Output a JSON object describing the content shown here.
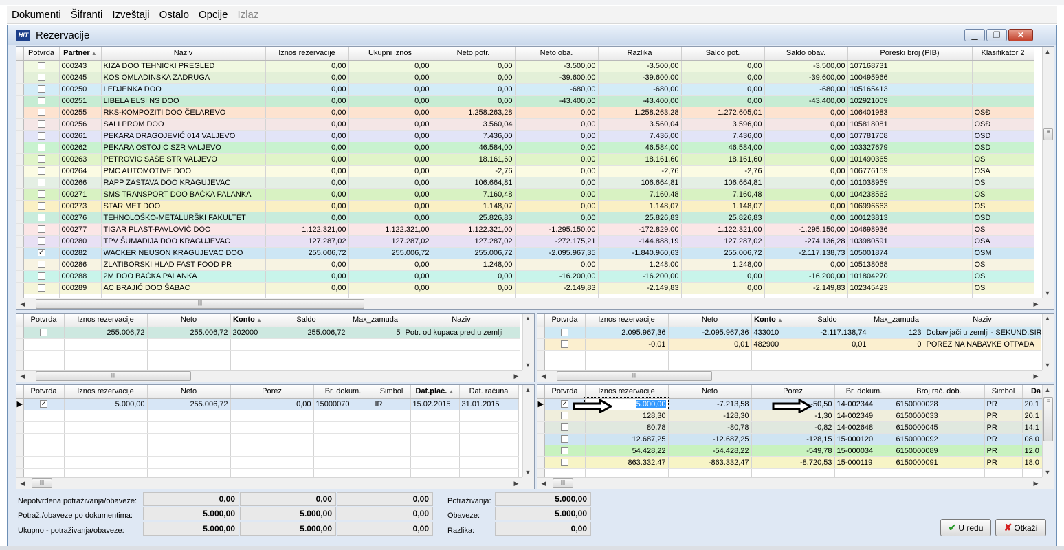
{
  "menu": [
    "Dokumenti",
    "Šifranti",
    "Izveštaji",
    "Ostalo",
    "Opcije",
    "Izlaz"
  ],
  "window": {
    "title": "Rezervacije",
    "logo": "HIT",
    "min_icon": "minimize-icon",
    "max_icon": "restore-icon",
    "close_icon": "close-icon"
  },
  "main_grid": {
    "columns": [
      "Potvrda",
      "Partner",
      "Naziv",
      "Iznos rezervacije",
      "Ukupni iznos",
      "Neto potr.",
      "Neto oba.",
      "Razlika",
      "Saldo pot.",
      "Saldo obav.",
      "Poreski broj (PIB)",
      "Klasifikator 2"
    ],
    "rows": [
      {
        "bg": "#f0f8e0",
        "checked": "",
        "cells": [
          "000243",
          "KIZA DOO TEHNICKI PREGLED",
          "0,00",
          "0,00",
          "0,00",
          "-3.500,00",
          "-3.500,00",
          "0,00",
          "-3.500,00",
          "107168731",
          ""
        ]
      },
      {
        "bg": "#e3f0d8",
        "checked": "",
        "cells": [
          "000245",
          "KOS OMLADINSKA ZADRUGA",
          "0,00",
          "0,00",
          "0,00",
          "-39.600,00",
          "-39.600,00",
          "0,00",
          "-39.600,00",
          "100495966",
          ""
        ]
      },
      {
        "bg": "#d3ecf7",
        "checked": "",
        "cells": [
          "000250",
          "LEDJENKA DOO",
          "0,00",
          "0,00",
          "0,00",
          "-680,00",
          "-680,00",
          "0,00",
          "-680,00",
          "105165413",
          ""
        ]
      },
      {
        "bg": "#c6ecd3",
        "checked": "",
        "cells": [
          "000251",
          "LIBELA ELSI NS DOO",
          "0,00",
          "0,00",
          "0,00",
          "-43.400,00",
          "-43.400,00",
          "0,00",
          "-43.400,00",
          "102921009",
          ""
        ]
      },
      {
        "bg": "#fde3d0",
        "checked": "",
        "cells": [
          "000255",
          "RKS-KOMPOZITI DOO  ČELAREVO",
          "0,00",
          "0,00",
          "1.258.263,28",
          "0,00",
          "1.258.263,28",
          "1.272.605,01",
          "0,00",
          "106401983",
          "OSĐ"
        ]
      },
      {
        "bg": "#f4e6e6",
        "checked": "",
        "cells": [
          "000256",
          "SALI PROM DOO",
          "0,00",
          "0,00",
          "3.560,04",
          "0,00",
          "3.560,04",
          "3.596,00",
          "0,00",
          "105818081",
          "OSĐ"
        ]
      },
      {
        "bg": "#e2e4f7",
        "checked": "",
        "cells": [
          "000261",
          "PEKARA DRAGOJEVIĆ 014  VALJEVO",
          "0,00",
          "0,00",
          "7.436,00",
          "0,00",
          "7.436,00",
          "7.436,00",
          "0,00",
          "107781708",
          "OSD"
        ]
      },
      {
        "bg": "#c8f2cf",
        "checked": "",
        "cells": [
          "000262",
          "PEKARA OSTOJIC SZR  VALJEVO",
          "0,00",
          "0,00",
          "46.584,00",
          "0,00",
          "46.584,00",
          "46.584,00",
          "0,00",
          "103327679",
          "OSD"
        ]
      },
      {
        "bg": "#e0f4c8",
        "checked": "",
        "cells": [
          "000263",
          "PETROVIC SAŠE  STR VALJEVO",
          "0,00",
          "0,00",
          "18.161,60",
          "0,00",
          "18.161,60",
          "18.161,60",
          "0,00",
          "101490365",
          "OS"
        ]
      },
      {
        "bg": "#fbfbe3",
        "checked": "",
        "cells": [
          "000264",
          "PMC AUTOMOTIVE DOO",
          "0,00",
          "0,00",
          "-2,76",
          "0,00",
          "-2,76",
          "-2,76",
          "0,00",
          "106776159",
          "OSA"
        ]
      },
      {
        "bg": "#e4efe4",
        "checked": "",
        "cells": [
          "000266",
          "RAPP ZASTAVA  DOO KRAGUJEVAC",
          "0,00",
          "0,00",
          "106.664,81",
          "0,00",
          "106.664,81",
          "106.664,81",
          "0,00",
          "101038959",
          "OS"
        ]
      },
      {
        "bg": "#d8f2c2",
        "checked": "",
        "cells": [
          "000271",
          "SMS TRANSPORT DOO BAČKA PALANKA",
          "0,00",
          "0,00",
          "7.160,48",
          "0,00",
          "7.160,48",
          "7.160,48",
          "0,00",
          "104238562",
          "OS"
        ]
      },
      {
        "bg": "#faf0c4",
        "checked": "",
        "cells": [
          "000273",
          "STAR MET DOO",
          "0,00",
          "0,00",
          "1.148,07",
          "0,00",
          "1.148,07",
          "1.148,07",
          "0,00",
          "106996663",
          "OS"
        ]
      },
      {
        "bg": "#c8ecdc",
        "checked": "",
        "cells": [
          "000276",
          "TEHNOLOŠKO-METALURŠKI FAKULTET",
          "0,00",
          "0,00",
          "25.826,83",
          "0,00",
          "25.826,83",
          "25.826,83",
          "0,00",
          "100123813",
          "OSD"
        ]
      },
      {
        "bg": "#fbe6e6",
        "checked": "",
        "cells": [
          "000277",
          "TIGAR PLAST-PAVLOVIĆ DOO",
          "1.122.321,00",
          "1.122.321,00",
          "1.122.321,00",
          "-1.295.150,00",
          "-172.829,00",
          "1.122.321,00",
          "-1.295.150,00",
          "104698936",
          "OS"
        ]
      },
      {
        "bg": "#e8e0f4",
        "checked": "",
        "cells": [
          "000280",
          "TPV ŠUMADIJA DOO KRAGUJEVAC",
          "127.287,02",
          "127.287,02",
          "127.287,02",
          "-272.175,21",
          "-144.888,19",
          "127.287,02",
          "-274.136,28",
          "103980591",
          "OSA"
        ]
      },
      {
        "bg": "#cde6f4",
        "checked": "✓",
        "cells": [
          "000282",
          "WACKER NEUSON KRAGUJEVAC DOO",
          "255.006,72",
          "255.006,72",
          "255.006,72",
          "-2.095.967,35",
          "-1.840.960,63",
          "255.006,72",
          "-2.117.138,73",
          "105001874",
          "OSM"
        ]
      },
      {
        "bg": "#f7f3e2",
        "checked": "",
        "cells": [
          "000286",
          "ZLATIBORSKI HLAD FAST FOOD PR",
          "0,00",
          "0,00",
          "1.248,00",
          "0,00",
          "1.248,00",
          "1.248,00",
          "0,00",
          "105138068",
          "OS"
        ]
      },
      {
        "bg": "#c8f4ea",
        "checked": "",
        "cells": [
          "000288",
          "2M DOO BAČKA PALANKA",
          "0,00",
          "0,00",
          "0,00",
          "-16.200,00",
          "-16.200,00",
          "0,00",
          "-16.200,00",
          "101804270",
          "OS"
        ]
      },
      {
        "bg": "#f5f5d8",
        "checked": "",
        "cells": [
          "000289",
          "AC BRAJIĆ DOO ŠABAC",
          "0,00",
          "0,00",
          "0,00",
          "-2.149,83",
          "-2.149,83",
          "0,00",
          "-2.149,83",
          "102345423",
          "OS"
        ]
      }
    ]
  },
  "mid_left": {
    "columns": [
      "Potvrda",
      "Iznos rezervacije",
      "Neto",
      "Konto",
      "Saldo",
      "Max_zamuda",
      "Naziv"
    ],
    "rows": [
      {
        "bg": "#cde8e0",
        "checked": "",
        "cells": [
          "255.006,72",
          "255.006,72",
          "202000",
          "255.006,72",
          "5",
          "Potr. od kupaca pred.u zemlji"
        ]
      }
    ]
  },
  "mid_right": {
    "columns": [
      "Potvrda",
      "Iznos rezervacije",
      "Neto",
      "Konto",
      "Saldo",
      "Max_zamuda",
      "Naziv"
    ],
    "rows": [
      {
        "bg": "#cfe9f5",
        "checked": "",
        "cells": [
          "2.095.967,36",
          "-2.095.967,36",
          "433010",
          "-2.117.138,74",
          "123",
          "Dobavljači u zemlji - SEKUND.SIR."
        ]
      },
      {
        "bg": "#fbefcf",
        "checked": "",
        "cells": [
          "-0,01",
          "0,01",
          "482900",
          "0,01",
          "0",
          "POREZ NA NABAVKE OTPADA"
        ]
      }
    ]
  },
  "bot_left": {
    "columns": [
      "Potvrda",
      "Iznos rezervacije",
      "Neto",
      "Porez",
      "Br. dokum.",
      "Simbol",
      "Dat.plać.",
      "Dat. računa"
    ],
    "rows": [
      {
        "bg": "#d7e6f6",
        "checked": "✓",
        "cells": [
          "5.000,00",
          "255.006,72",
          "0,00",
          "15000070",
          "IR",
          "15.02.2015",
          "31.01.2015"
        ]
      }
    ]
  },
  "bot_right": {
    "columns": [
      "Potvrda",
      "Iznos rezervacije",
      "Neto",
      "Porez",
      "Br. dokum.",
      "Broj rač. dob.",
      "Simbol",
      "Da"
    ],
    "rows": [
      {
        "bg": "#d7e6f6",
        "checked": "✓",
        "cells": [
          "5.000,00",
          "-7.213,58",
          "-50,50",
          "14-002344",
          "6150000028",
          "PR",
          "20.1"
        ]
      },
      {
        "bg": "#f0eedc",
        "checked": "",
        "cells": [
          "128,30",
          "-128,30",
          "-1,30",
          "14-002349",
          "6150000033",
          "PR",
          "20.1"
        ]
      },
      {
        "bg": "#e0e8df",
        "checked": "",
        "cells": [
          "80,78",
          "-80,78",
          "-0,82",
          "14-002648",
          "6150000045",
          "PR",
          "14.1"
        ]
      },
      {
        "bg": "#cfe4f2",
        "checked": "",
        "cells": [
          "12.687,25",
          "-12.687,25",
          "-128,15",
          "15-000120",
          "6150000092",
          "PR",
          "08.0"
        ]
      },
      {
        "bg": "#c8f2bf",
        "checked": "",
        "cells": [
          "54.428,22",
          "-54.428,22",
          "-549,78",
          "15-000034",
          "6150000089",
          "PR",
          "12.0"
        ]
      },
      {
        "bg": "#f7f4c6",
        "checked": "",
        "cells": [
          "863.332,47",
          "-863.332,47",
          "-8.720,53",
          "15-000119",
          "6150000091",
          "PR",
          "18.0"
        ]
      }
    ]
  },
  "summary": {
    "labels": [
      "Nepotvrđena potraživanja/obaveze:",
      "Potraž./obaveze po dokumentima:",
      "Ukupno - potraživanja/obaveze:"
    ],
    "values": [
      [
        "0,00",
        "0,00",
        "0,00"
      ],
      [
        "5.000,00",
        "5.000,00",
        "0,00"
      ],
      [
        "5.000,00",
        "5.000,00",
        "0,00"
      ]
    ],
    "right_labels": [
      "Potraživanja:",
      "Obaveze:",
      "Razlika:"
    ],
    "right_values": [
      "5.000,00",
      "5.000,00",
      "0,00"
    ]
  },
  "buttons": {
    "ok": "U redu",
    "cancel": "Otkaži",
    "ok_icon": "check-icon",
    "cancel_icon": "cross-icon"
  }
}
